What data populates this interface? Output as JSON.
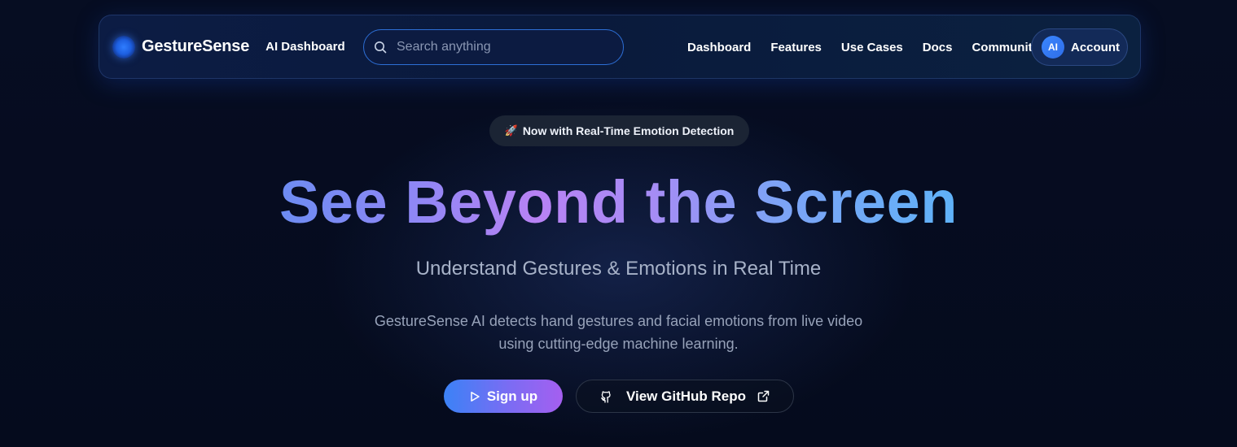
{
  "nav": {
    "brand_name": "GestureSense",
    "ai_dashboard": "AI Dashboard",
    "search_placeholder": "Search anything",
    "links": [
      "Dashboard",
      "Features",
      "Use Cases",
      "Docs",
      "Community"
    ],
    "account": {
      "avatar_initials": "AI",
      "label": "Account"
    }
  },
  "badge": {
    "icon": "rocket-icon",
    "icon_glyph": "🚀",
    "text": "Now with Real-Time Emotion Detection"
  },
  "hero": {
    "title": "See Beyond the Screen",
    "subtitle": "Understand Gestures & Emotions in Real Time",
    "description_line1": "GestureSense AI detects hand gestures and facial emotions from live video",
    "description_line2": "using cutting-edge machine learning."
  },
  "buttons": {
    "signup": {
      "label": "Sign up",
      "icon": "play-icon"
    },
    "github": {
      "label": "View GitHub Repo",
      "icon": "github-icon",
      "trailing_icon": "external-link-icon"
    }
  },
  "colors": {
    "background": "#050b1d",
    "nav_background": "#0c1c44",
    "search_border": "#2d6fd6",
    "accent_blue": "#3b82f6",
    "accent_purple": "#a55ff0",
    "title_gradient_start": "#6d8cf2",
    "title_gradient_mid": "#b882f4",
    "title_gradient_end": "#5fb2f8"
  }
}
